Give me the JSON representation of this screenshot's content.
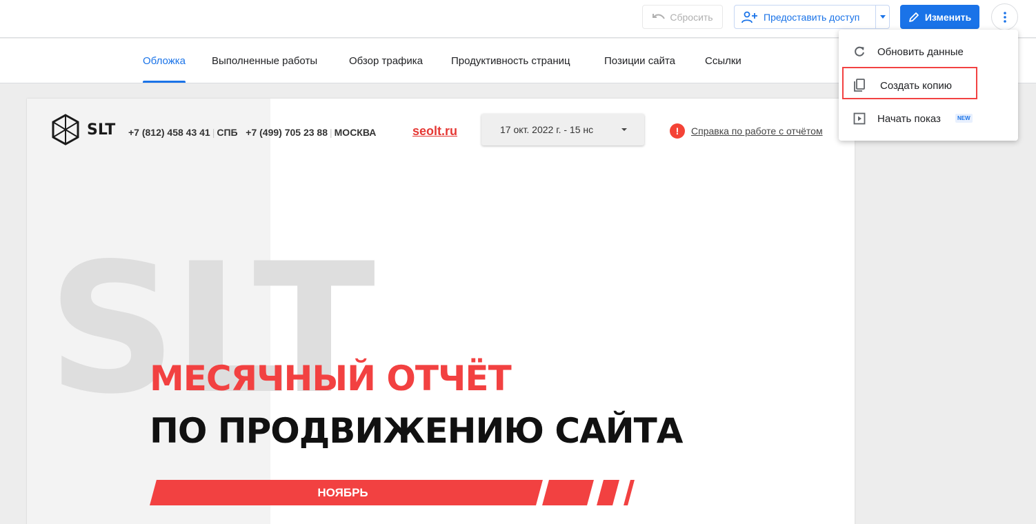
{
  "toolbar": {
    "reset_label": "Сбросить",
    "share_label": "Предоставить доступ",
    "edit_label": "Изменить"
  },
  "tabs": [
    {
      "label": "Обложка",
      "active": true
    },
    {
      "label": "Выполненные работы",
      "active": false
    },
    {
      "label": "Обзор трафика",
      "active": false
    },
    {
      "label": "Продуктивность страниц",
      "active": false
    },
    {
      "label": "Позиции сайта",
      "active": false
    },
    {
      "label": "Ссылки",
      "active": false
    }
  ],
  "report": {
    "logo_text": "SLT",
    "phone_spb": "+7 (812) 458 43 41",
    "city_spb": "СПБ",
    "phone_msk": "+7 (499) 705 23 88",
    "city_msk": "МОСКВА",
    "site": "seolt.ru",
    "date_range": "17 окт. 2022 г. - 15 нс",
    "help_icon": "!",
    "help_text": "Справка по работе с отчётом",
    "bg_text": "SLT",
    "title_line1": "МЕСЯЧНЫЙ ОТЧЁТ",
    "title_line2": "ПО ПРОДВИЖЕНИЮ САЙТА",
    "month": "НОЯБРЬ"
  },
  "menu": {
    "items": [
      {
        "label": "Обновить данные",
        "icon": "refresh-icon"
      },
      {
        "label": "Создать копию",
        "icon": "copy-icon"
      },
      {
        "label": "Начать показ",
        "icon": "present-icon",
        "badge": "NEW"
      }
    ]
  },
  "colors": {
    "accent_blue": "#1a73e8",
    "brand_red": "#f24141"
  }
}
